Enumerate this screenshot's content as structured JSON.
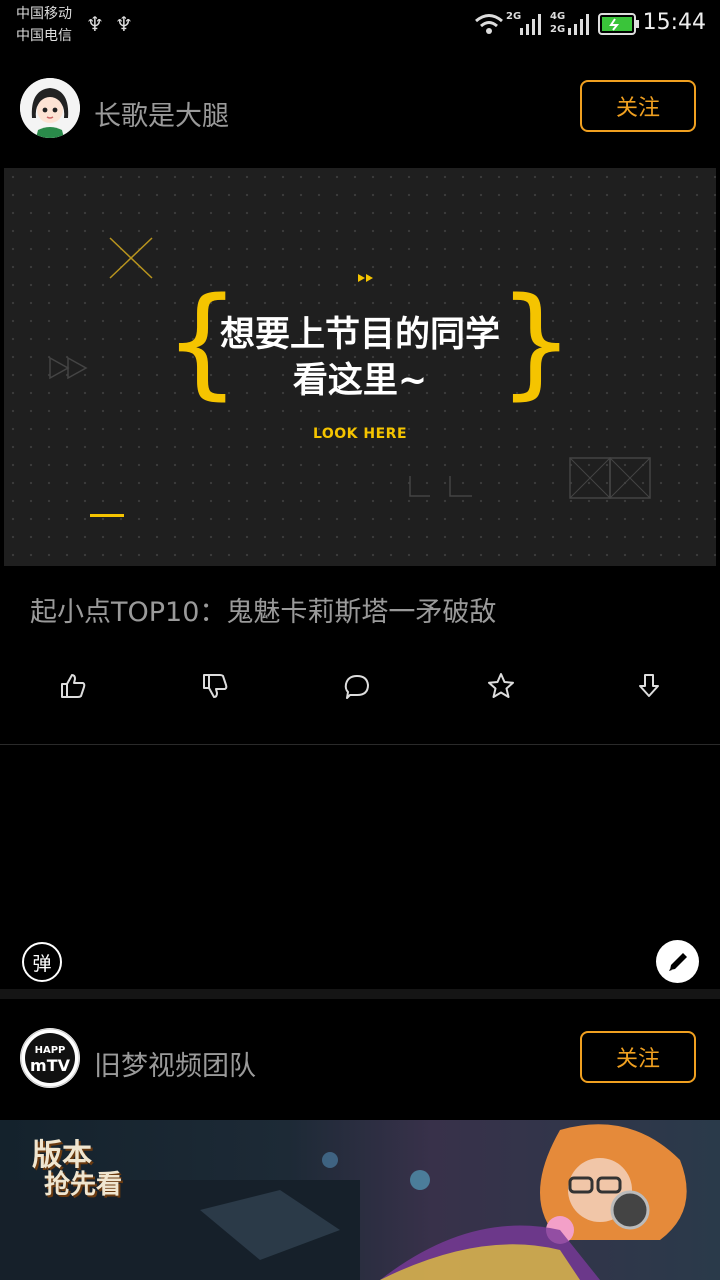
{
  "status_bar": {
    "carrier1": "中国移动",
    "carrier2": "中国电信",
    "sig1_type": "2G",
    "sig2_top": "4G",
    "sig2_bottom": "2G",
    "time": "15:44"
  },
  "post1": {
    "author": "长歌是大腿",
    "follow": "关注",
    "video_line1": "想要上节目的同学",
    "video_line2": "看这里~",
    "look_here": "LOOK HERE",
    "title": "起小点TOP10：鬼魅卡莉斯塔一矛破敌"
  },
  "danmaku": {
    "label": "弹"
  },
  "post2": {
    "author": "旧梦视频团队",
    "follow": "关注",
    "avatar_text_top": "HAPP",
    "avatar_text_bottom": "mTV",
    "banner_line1": "版本",
    "banner_line2": "抢先看"
  },
  "colors": {
    "accent": "#f0a020",
    "video_yellow": "#f5c400"
  }
}
